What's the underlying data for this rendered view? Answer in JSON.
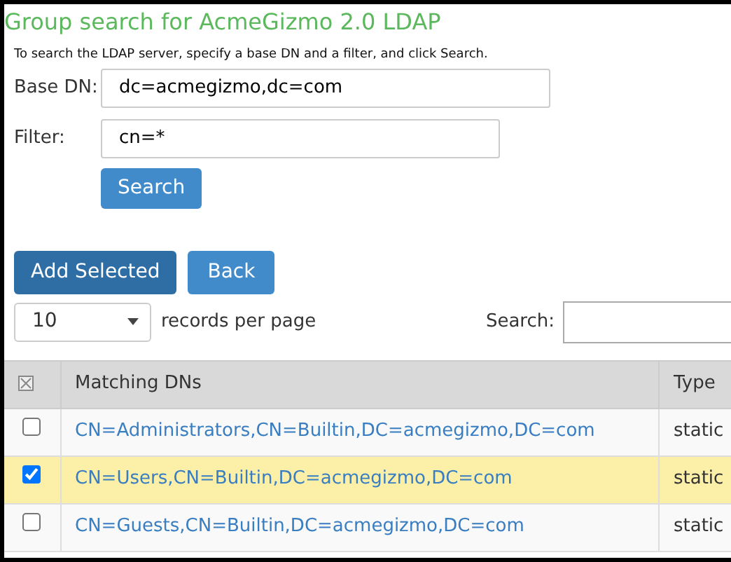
{
  "title": "Group search for AcmeGizmo 2.0 LDAP",
  "instructions": "To search the LDAP server, specify a base DN and a filter, and click Search.",
  "fields": [
    {
      "label": "Base DN:",
      "value": "dc=acmegizmo,dc=com"
    },
    {
      "label": "Filter:",
      "value": "cn=*"
    }
  ],
  "search_button": "Search",
  "actions": [
    {
      "label": "Add Selected",
      "kind": "primary"
    },
    {
      "label": "Back",
      "kind": "secondary"
    }
  ],
  "page_size": {
    "value": "10",
    "label": "records per page"
  },
  "table_search": {
    "label": "Search:"
  },
  "table": {
    "columns": [
      "Matching DNs",
      "Type"
    ],
    "rows": [
      {
        "dn": "CN=Administrators,CN=Builtin,DC=acmegizmo,DC=com",
        "type": "static",
        "selected": false
      },
      {
        "dn": "CN=Users,CN=Builtin,DC=acmegizmo,DC=com",
        "type": "static",
        "selected": true
      },
      {
        "dn": "CN=Guests,CN=Builtin,DC=acmegizmo,DC=com",
        "type": "static",
        "selected": false
      }
    ]
  }
}
